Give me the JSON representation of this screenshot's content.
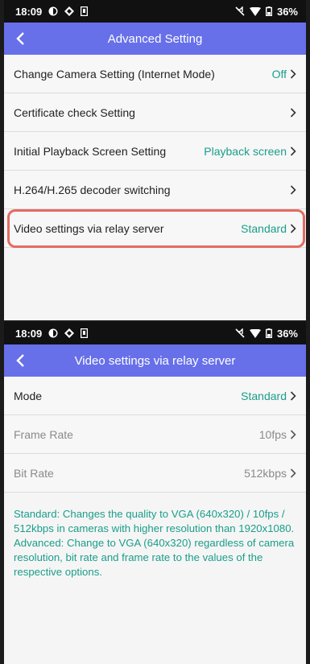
{
  "screen1": {
    "status": {
      "time": "18:09",
      "battery": "36%"
    },
    "header": {
      "title": "Advanced Setting"
    },
    "rows": [
      {
        "label": "Change Camera Setting (Internet Mode)",
        "value": "Off"
      },
      {
        "label": "Certificate check Setting",
        "value": ""
      },
      {
        "label": "Initial Playback Screen Setting",
        "value": "Playback screen"
      },
      {
        "label": "H.264/H.265 decoder switching",
        "value": ""
      },
      {
        "label": "Video settings via relay server",
        "value": "Standard"
      }
    ],
    "highlight_color": "#e46b62"
  },
  "screen2": {
    "status": {
      "time": "18:09",
      "battery": "36%"
    },
    "header": {
      "title": "Video settings via relay server"
    },
    "rows": [
      {
        "label": "Mode",
        "value": "Standard"
      },
      {
        "label": "Frame Rate",
        "value": "10fps"
      },
      {
        "label": "Bit Rate",
        "value": "512kbps"
      }
    ],
    "note": {
      "standard": "Standard: Changes the quality to VGA (640x320) / 10fps / 512kbps in cameras with higher resolution than 1920x1080.",
      "advanced": "Advanced: Change to VGA (640x320) regardless of camera resolution, bit rate and frame rate to the values of the respective options."
    }
  },
  "colors": {
    "accent": "#6770e9",
    "teal": "#1a9e8a",
    "statusbar": "#111111"
  },
  "icons": [
    "back-arrow-icon",
    "chevron-right-icon",
    "wifi-icon",
    "battery-icon",
    "mute-icon",
    "notification-icons"
  ]
}
